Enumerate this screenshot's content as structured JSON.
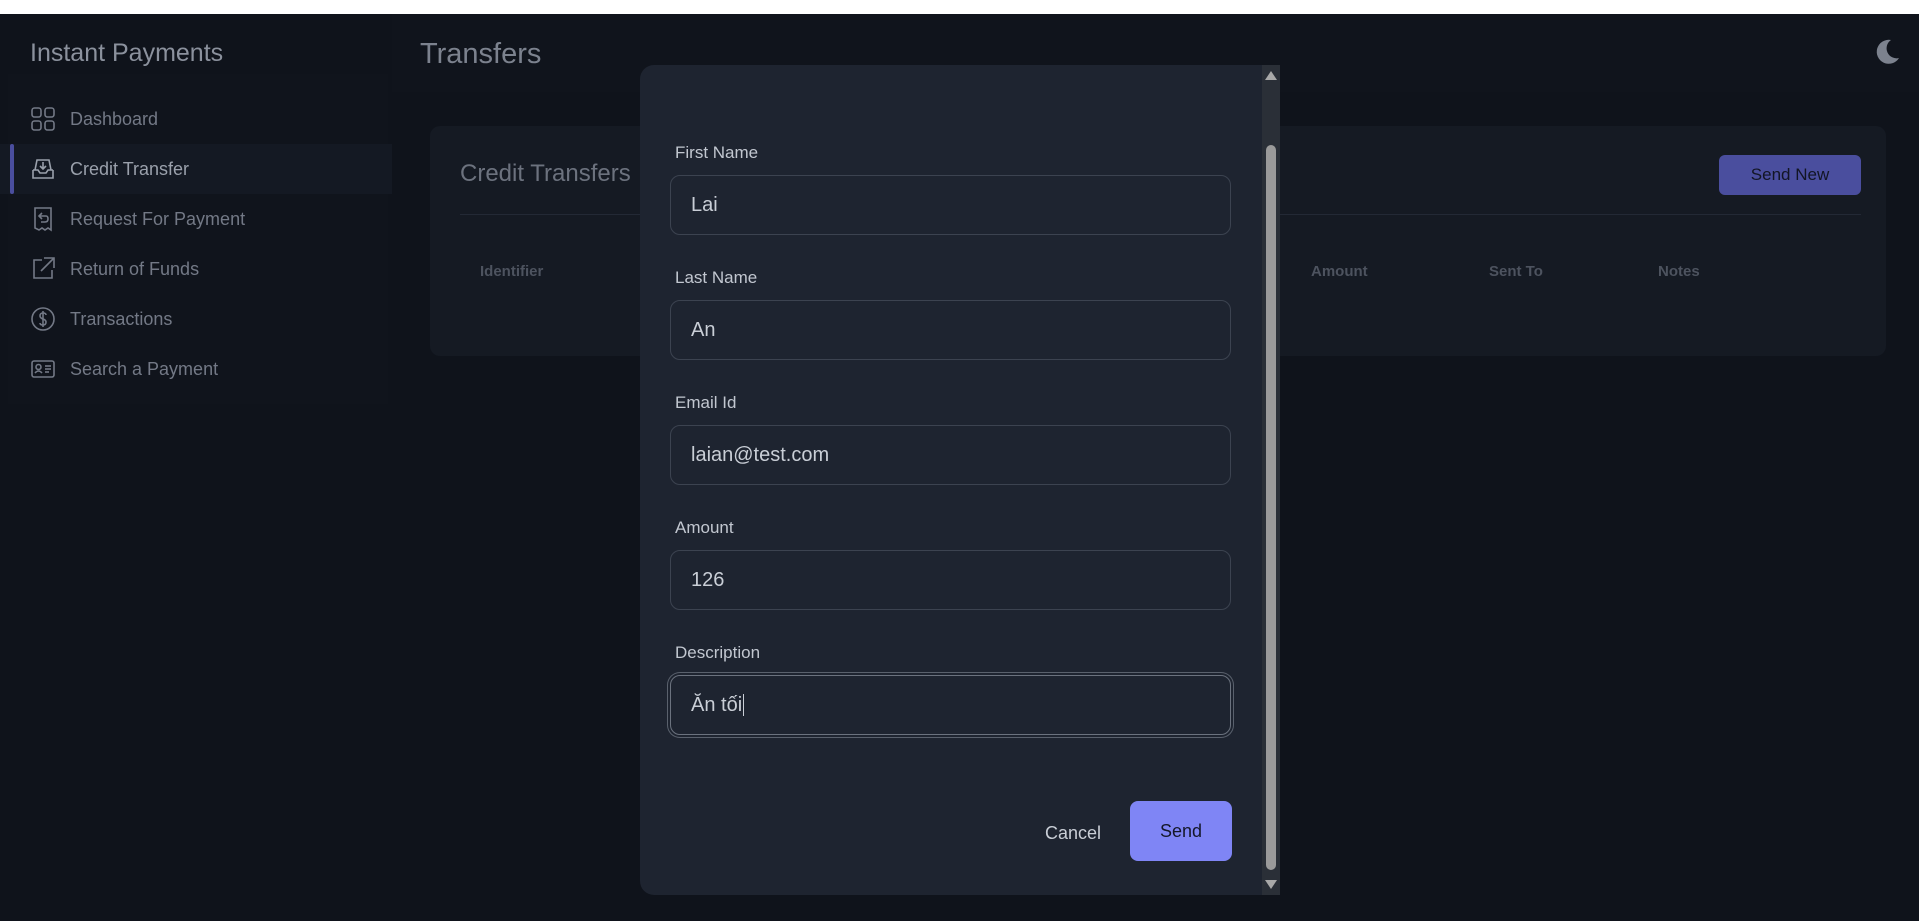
{
  "sidebar": {
    "brand": "Instant Payments",
    "items": [
      {
        "label": "Dashboard",
        "icon": "grid-icon"
      },
      {
        "label": "Credit Transfer",
        "icon": "inbox-download-icon"
      },
      {
        "label": "Request For Payment",
        "icon": "receipt-return-icon"
      },
      {
        "label": "Return of Funds",
        "icon": "external-link-icon"
      },
      {
        "label": "Transactions",
        "icon": "dollar-circle-icon"
      },
      {
        "label": "Search a Payment",
        "icon": "id-card-icon"
      }
    ],
    "active_index": 1
  },
  "header": {
    "title": "Transfers",
    "theme_icon": "moon-icon"
  },
  "card": {
    "title": "Credit Transfers",
    "send_new_label": "Send New",
    "columns": [
      "Identifier",
      "Amount",
      "Sent To",
      "Notes"
    ]
  },
  "modal": {
    "fields": [
      {
        "label": "First Name",
        "value": "Lai"
      },
      {
        "label": "Last Name",
        "value": "An"
      },
      {
        "label": "Email Id",
        "value": "laian@test.com"
      },
      {
        "label": "Amount",
        "value": "126"
      },
      {
        "label": "Description",
        "value": "Ăn tối"
      }
    ],
    "cancel_label": "Cancel",
    "send_label": "Send"
  },
  "colors": {
    "background": "#0f131b",
    "modal": "#1e2430",
    "accent": "#7f85f5",
    "accent_dim": "#4a4e9e"
  }
}
